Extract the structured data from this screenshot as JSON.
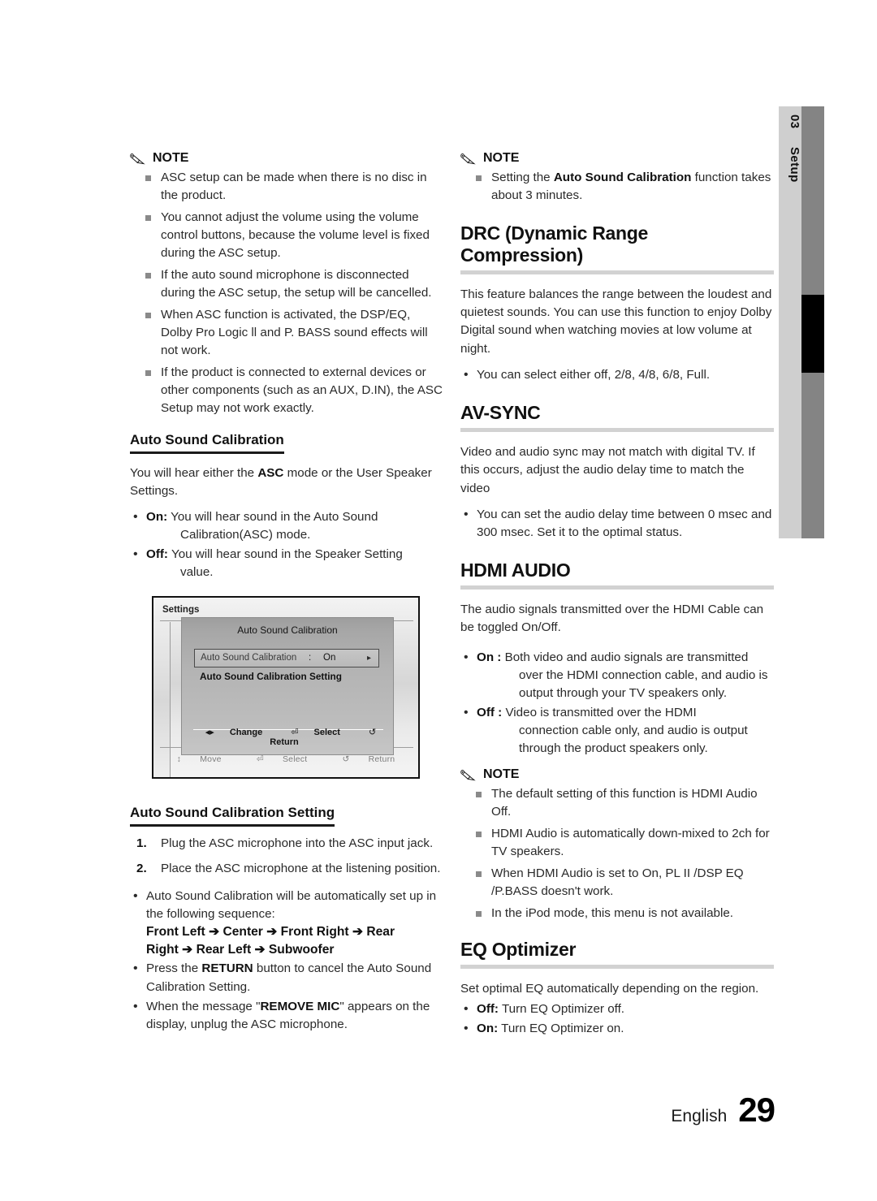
{
  "page_tab": {
    "chapter_number": "03",
    "chapter_label": "Setup"
  },
  "left_column": {
    "note_1": {
      "title": "NOTE",
      "items": [
        "ASC setup can be made when there is no disc in the product.",
        "You cannot adjust the volume using the volume control buttons, because the volume level is fixed during the ASC setup.",
        "If the auto sound microphone is disconnected during the ASC setup, the setup will be cancelled.",
        "When ASC function is activated, the DSP/EQ, Dolby Pro Logic ll and P. BASS sound effects will not work.",
        "If the product is connected to external devices or other components (such as an AUX, D.IN), the ASC Setup may not work exactly."
      ]
    },
    "auto_sound_calibration": {
      "heading": "Auto Sound Calibration",
      "intro_before": "You will hear either the ",
      "intro_bold": "ASC",
      "intro_after": " mode or the User Speaker Settings.",
      "options": [
        {
          "label": "On:",
          "text": "You will hear sound in the Auto Sound",
          "cont": "Calibration(ASC) mode."
        },
        {
          "label": "Off:",
          "text": "You will hear sound in the Speaker Setting",
          "cont": "value."
        }
      ]
    },
    "osd_screenshot": {
      "settings_label": "Settings",
      "dialog_title": "Auto Sound Calibration",
      "row_label": "Auto Sound Calibration",
      "row_colon": ":",
      "row_value": "On",
      "row_arrow": "▸",
      "row_2_label": "Auto Sound Calibration Setting",
      "dialog_hints": [
        {
          "glyph": "◂▸",
          "label": "Change"
        },
        {
          "glyph": "⏎",
          "label": "Select"
        },
        {
          "glyph": "↺",
          "label": "Return"
        }
      ],
      "background_hints": [
        {
          "glyph": "↕",
          "label": "Move"
        },
        {
          "glyph": "⏎",
          "label": "Select"
        },
        {
          "glyph": "↺",
          "label": "Return"
        }
      ]
    },
    "auto_sound_calibration_setting": {
      "heading": "Auto Sound Calibration Setting",
      "steps": [
        "Plug the ASC microphone into the ASC input jack.",
        "Place the ASC microphone at the listening position."
      ],
      "bullets": [
        {
          "text": "Auto Sound Calibration will be automatically set up in the following sequence:",
          "sequence_line_1": "Front Left ➔ Center ➔ Front Right ➔ Rear",
          "sequence_line_2": "Right ➔ Rear Left ➔ Subwoofer"
        },
        {
          "pre": "Press the ",
          "bold": "RETURN",
          "post": " button to cancel the Auto Sound Calibration Setting."
        },
        {
          "pre": "When the message \"",
          "bold": "REMOVE MIC",
          "post": "\" appears on the display, unplug the ASC microphone."
        }
      ]
    }
  },
  "right_column": {
    "note_1": {
      "title": "NOTE",
      "item_pre": "Setting the ",
      "item_bold": "Auto Sound Calibration",
      "item_post": " function takes about 3 minutes."
    },
    "drc": {
      "heading": "DRC (Dynamic Range Compression)",
      "body": "This feature balances the range between the loudest and quietest sounds. You can use this function to enjoy Dolby Digital sound when watching movies at low volume at night.",
      "bullet": "You can select either off, 2/8, 4/8, 6/8, Full."
    },
    "av_sync": {
      "heading": "AV-SYNC",
      "body": "Video and audio sync may not match with digital TV. If this occurs, adjust the audio delay time to match the video",
      "bullet": "You can set the audio delay time between 0 msec and 300 msec. Set it to the optimal status."
    },
    "hdmi_audio": {
      "heading": "HDMI AUDIO",
      "body": "The audio signals transmitted over the HDMI Cable can be toggled On/Off.",
      "options": [
        {
          "label": "On :",
          "text": "Both video and audio signals are transmitted",
          "cont": "over the HDMI connection cable, and audio is output through your TV speakers only."
        },
        {
          "label": "Off :",
          "text": "Video is transmitted over the HDMI",
          "cont": "connection cable only, and audio is output through the product speakers only."
        }
      ],
      "note": {
        "title": "NOTE",
        "items": [
          "The default setting of this function is HDMI Audio Off.",
          "HDMI Audio is automatically down-mixed to 2ch for TV speakers.",
          "When HDMI Audio is set to On, PL II /DSP EQ /P.BASS doesn't work.",
          "In the iPod mode, this menu is not available."
        ]
      }
    },
    "eq_optimizer": {
      "heading": "EQ Optimizer",
      "body": "Set optimal EQ automatically depending on the region.",
      "options": [
        {
          "label": "Off:",
          "text": "Turn EQ Optimizer off."
        },
        {
          "label": "On:",
          "text": "Turn EQ Optimizer on."
        }
      ]
    }
  },
  "footer": {
    "language": "English",
    "page_number": "29"
  }
}
